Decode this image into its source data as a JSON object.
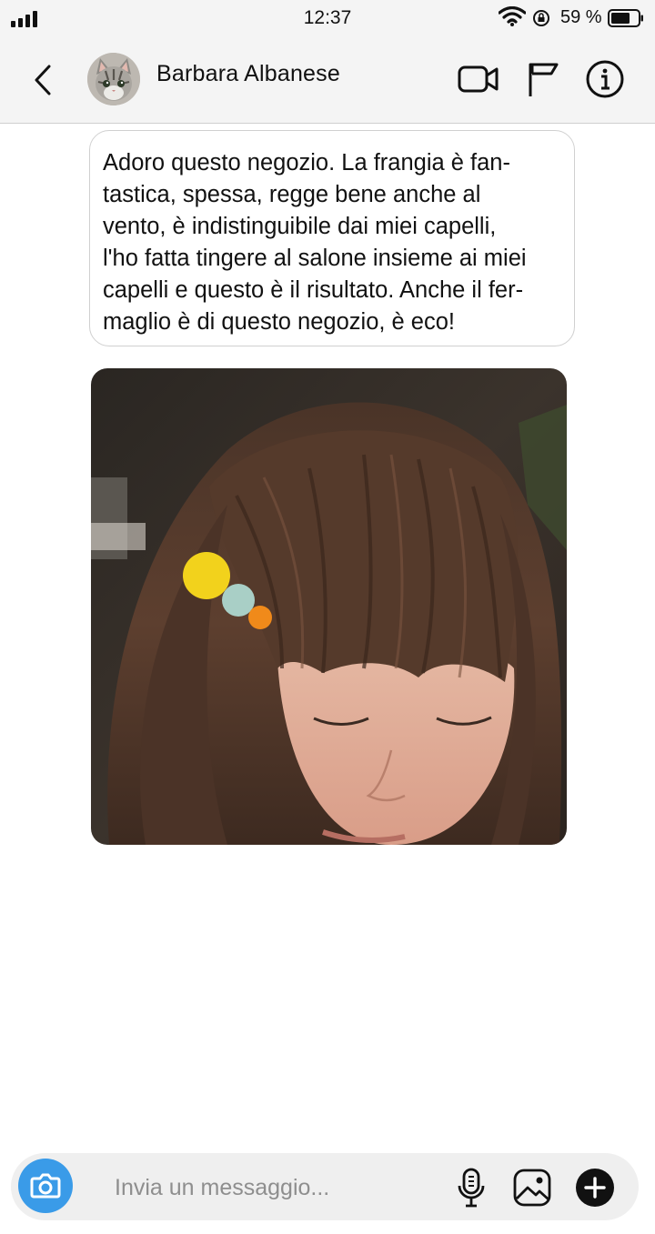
{
  "status_bar": {
    "time": "12:37",
    "battery_percent": "59 %",
    "icons": [
      "signal-icon",
      "wifi-icon",
      "rotation-lock-icon",
      "battery-icon"
    ]
  },
  "header": {
    "contact_name": "Barbara Albanese",
    "icons": [
      "back-chevron-icon",
      "avatar",
      "video-call-icon",
      "flag-icon",
      "info-icon"
    ]
  },
  "conversation": {
    "message_text": "Adoro questo negozio. La frangia è fan-tastica, spessa, regge bene anche al vento, è indistinguibile dai miei capelli, l'ho fatta tingere al salone insieme ai miei capelli e questo è il risultato. Anche il fer-maglio è di questo negozio, è eco!",
    "message_lines": [
      "Adoro questo negozio. La frangia è fan-",
      "tastica, spessa, regge bene anche al",
      "vento, è indistinguibile dai miei capelli,",
      "l'ho fatta tingere al salone insieme ai miei",
      "capelli e questo è il risultato. Anche il fer-",
      "maglio è di questo negozio, è eco!"
    ],
    "image_description_icon": "photo-message"
  },
  "composer": {
    "placeholder": "Invia un messaggio...",
    "icons": [
      "camera-icon",
      "microphone-icon",
      "gallery-icon",
      "plus-icon"
    ]
  },
  "colors": {
    "camera_button": "#3a9be8",
    "bar_background": "#f4f4f4",
    "input_background": "#efefef"
  }
}
